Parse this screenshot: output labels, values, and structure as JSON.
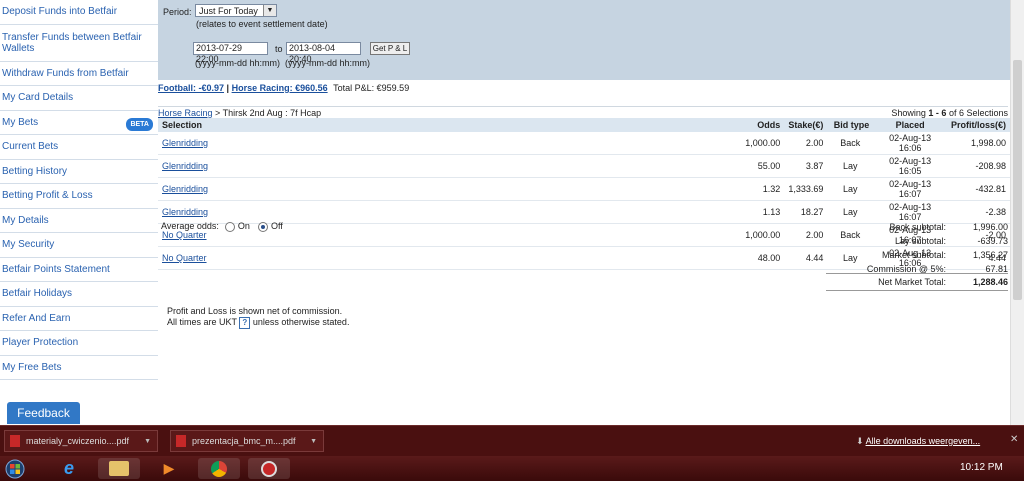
{
  "sidebar": {
    "items": [
      {
        "label": "Deposit Funds into Betfair"
      },
      {
        "label": "Transfer Funds between Betfair Wallets"
      },
      {
        "label": "Withdraw Funds from Betfair"
      },
      {
        "label": "My Card Details"
      },
      {
        "label": "My Bets",
        "badge": "BETA"
      },
      {
        "label": "Current Bets"
      },
      {
        "label": "Betting History"
      },
      {
        "label": "Betting Profit & Loss"
      },
      {
        "label": "My Details"
      },
      {
        "label": "My Security"
      },
      {
        "label": "Betfair Points Statement"
      },
      {
        "label": "Betfair Holidays"
      },
      {
        "label": "Refer And Earn"
      },
      {
        "label": "Player Protection"
      },
      {
        "label": "My Free Bets"
      }
    ],
    "feedback_label": "Feedback"
  },
  "filter": {
    "period_label": "Period:",
    "period_value": "Just For Today",
    "period_note": "(relates to event settlement date)",
    "from_value": "2013-07-29 22:00",
    "to_label": "to",
    "to_value": "2013-08-04 20:40",
    "button_label": "Get P & L",
    "from_hint": "(yyyy-mm-dd hh:mm)",
    "to_hint": "(yyyy-mm-dd hh:mm)"
  },
  "summary": {
    "football": "Football: -€0.97",
    "separator": "|",
    "horse": "Horse Racing: €960.56",
    "total": "Total P&L:  €959.59"
  },
  "breadcrumb": {
    "root": "Horse Racing",
    "rest": "> Thirsk 2nd Aug : 7f Hcap"
  },
  "showing": {
    "prefix": "Showing",
    "range": "1 - 6",
    "suffix": "of 6 Selections"
  },
  "table": {
    "headers": [
      "Selection",
      "Odds",
      "Stake(€)",
      "Bid type",
      "Placed",
      "Profit/loss(€)"
    ],
    "rows": [
      [
        "Glenridding",
        "1,000.00",
        "2.00",
        "Back",
        "02-Aug-13 16:06",
        "1,998.00"
      ],
      [
        "Glenridding",
        "55.00",
        "3.87",
        "Lay",
        "02-Aug-13 16:05",
        "-208.98"
      ],
      [
        "Glenridding",
        "1.32",
        "1,333.69",
        "Lay",
        "02-Aug-13 16:07",
        "-432.81"
      ],
      [
        "Glenridding",
        "1.13",
        "18.27",
        "Lay",
        "02-Aug-13 16:07",
        "-2.38"
      ],
      [
        "No Quarter",
        "1,000.00",
        "2.00",
        "Back",
        "02-Aug-13 16:07",
        "-2.00"
      ],
      [
        "No Quarter",
        "48.00",
        "4.44",
        "Lay",
        "02-Aug-13 16:06",
        "4.44"
      ]
    ]
  },
  "avg_odds": {
    "label": "Average odds:",
    "on": "On",
    "off": "Off"
  },
  "subtotals": [
    {
      "label": "Back subtotal:",
      "value": "1,996.00"
    },
    {
      "label": "Lay subtotal:",
      "value": "-639.73"
    },
    {
      "label": "Market subtotal:",
      "value": "1,356.27"
    },
    {
      "label": "Commission @ 5%:",
      "value": "67.81"
    },
    {
      "label": "Net Market Total:",
      "value": "1,288.46"
    }
  ],
  "notes": {
    "line1": "Profit and Loss is shown net of commission.",
    "line2_a": "All times are UKT",
    "help": "?",
    "line2_b": "unless otherwise stated."
  },
  "downloads": {
    "items": [
      {
        "name": "materialy_cwiczenio....pdf"
      },
      {
        "name": "prezentacja_bmc_m....pdf"
      }
    ],
    "all_label": "Alle downloads weergeven..."
  },
  "taskbar": {
    "time": "10:12 PM"
  },
  "colors": {
    "link": "#1a4f9c",
    "filter_bg": "#c6d4e1",
    "downloads_bg": "#4a1010"
  }
}
